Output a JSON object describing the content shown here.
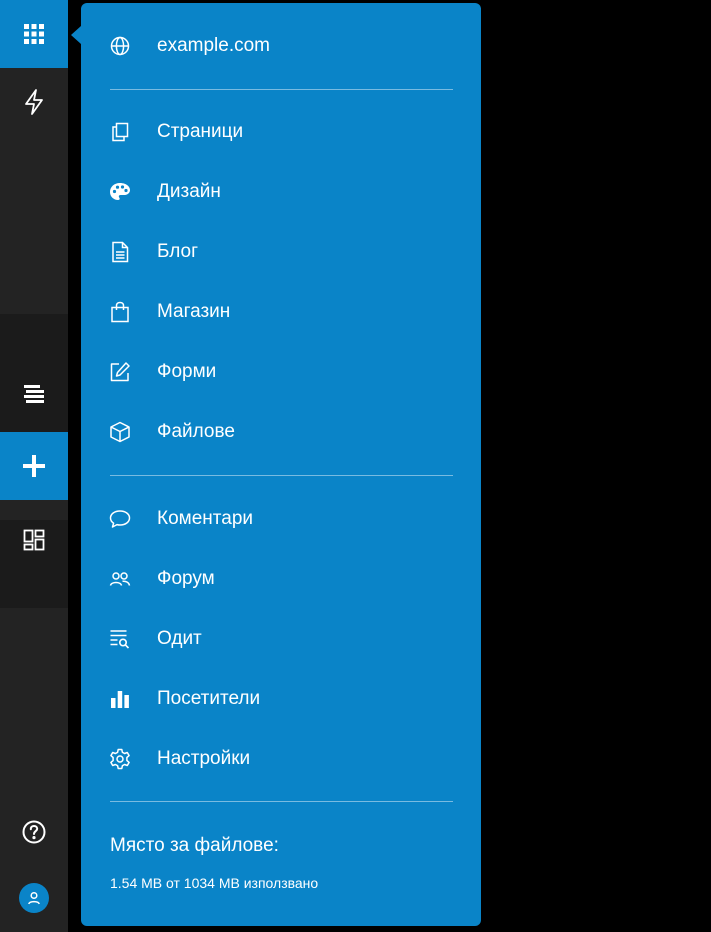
{
  "site": {
    "domain": "example.com"
  },
  "menu": {
    "group1": [
      {
        "label": "Страници",
        "icon": "pages-icon"
      },
      {
        "label": "Дизайн",
        "icon": "palette-icon"
      },
      {
        "label": "Блог",
        "icon": "document-icon"
      },
      {
        "label": "Магазин",
        "icon": "shopping-bag-icon"
      },
      {
        "label": "Форми",
        "icon": "edit-icon"
      },
      {
        "label": "Файлове",
        "icon": "box-icon"
      }
    ],
    "group2": [
      {
        "label": "Коментари",
        "icon": "comment-icon"
      },
      {
        "label": "Форум",
        "icon": "users-icon"
      },
      {
        "label": "Одит",
        "icon": "audit-icon"
      },
      {
        "label": "Посетители",
        "icon": "bar-chart-icon"
      },
      {
        "label": "Настройки",
        "icon": "gear-icon"
      }
    ]
  },
  "storage": {
    "title": "Място за файлове:",
    "usage": "1.54 MB от 1034 MB използвано"
  },
  "colors": {
    "accent": "#0a84c8",
    "rail": "#232323",
    "background": "#000000"
  }
}
